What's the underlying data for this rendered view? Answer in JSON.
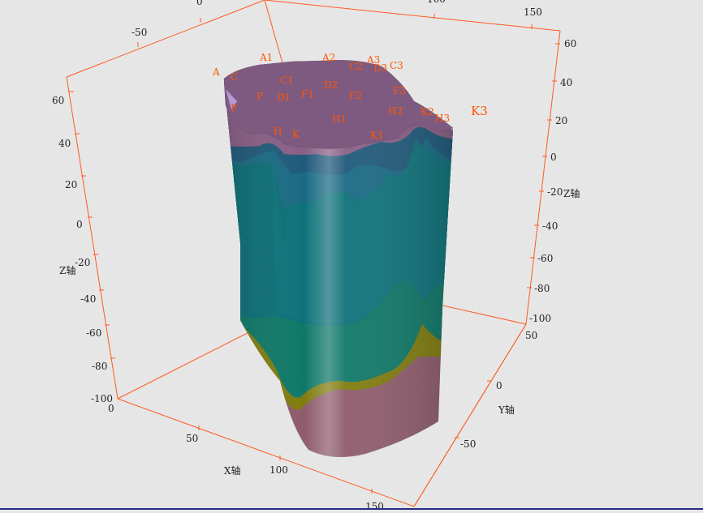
{
  "scene": {
    "axes": {
      "x": {
        "title": "X轴",
        "ticks": [
          "0",
          "50",
          "100",
          "150"
        ]
      },
      "y": {
        "title": "Y轴",
        "ticks": [
          "50",
          "0",
          "-50"
        ]
      },
      "z_left": {
        "title": "Z轴",
        "ticks": [
          "60",
          "40",
          "20",
          "0",
          "-20",
          "-40",
          "-60",
          "-80",
          "-100"
        ]
      },
      "z_right": {
        "title": "Z轴",
        "ticks": [
          "60",
          "40",
          "20",
          "0",
          "-20",
          "-40",
          "-60",
          "-80",
          "-100"
        ]
      },
      "top_x": {
        "ticks": [
          "-50",
          "0"
        ]
      },
      "top_y": {
        "ticks": [
          "100",
          "150"
        ]
      }
    },
    "boreholes": [
      "A",
      "A1",
      "A2",
      "A3",
      "C",
      "C1",
      "C2",
      "C3",
      "D1",
      "D2",
      "D3",
      "F",
      "F1",
      "F2",
      "F3",
      "H",
      "H1",
      "H2",
      "H3",
      "K",
      "K1",
      "K2",
      "K3",
      "F"
    ],
    "colors": {
      "frame": "#ff5a1f",
      "label": "#ff5500",
      "top_layer": "#8a5f85",
      "layer_blue": "#1e5f80",
      "layer_teal": "#0d6e75",
      "layer_green": "#0f7a6a",
      "layer_olive": "#807c10",
      "bottom_layer": "#8e5c6c"
    }
  }
}
